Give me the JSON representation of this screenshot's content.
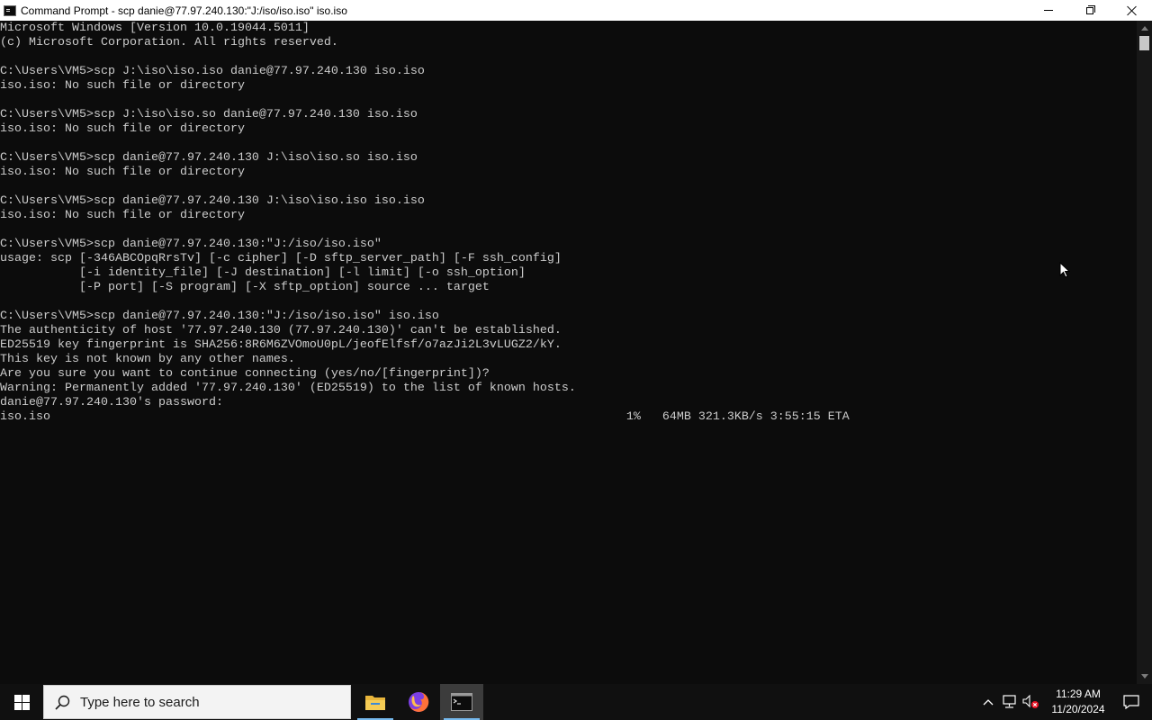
{
  "window": {
    "title": "Command Prompt - scp  danie@77.97.240.130:\"J:/iso/iso.iso\" iso.iso",
    "icon": "cmd-icon",
    "controls": [
      "minimize-icon",
      "restore-icon",
      "close-icon"
    ]
  },
  "console": {
    "lines": [
      "Microsoft Windows [Version 10.0.19044.5011]",
      "(c) Microsoft Corporation. All rights reserved.",
      "",
      "C:\\Users\\VM5>scp J:\\iso\\iso.iso danie@77.97.240.130 iso.iso",
      "iso.iso: No such file or directory",
      "",
      "C:\\Users\\VM5>scp J:\\iso\\iso.so danie@77.97.240.130 iso.iso",
      "iso.iso: No such file or directory",
      "",
      "C:\\Users\\VM5>scp danie@77.97.240.130 J:\\iso\\iso.so iso.iso",
      "iso.iso: No such file or directory",
      "",
      "C:\\Users\\VM5>scp danie@77.97.240.130 J:\\iso\\iso.iso iso.iso",
      "iso.iso: No such file or directory",
      "",
      "C:\\Users\\VM5>scp danie@77.97.240.130:\"J:/iso/iso.iso\"",
      "usage: scp [-346ABCOpqRrsTv] [-c cipher] [-D sftp_server_path] [-F ssh_config]",
      "           [-i identity_file] [-J destination] [-l limit] [-o ssh_option]",
      "           [-P port] [-S program] [-X sftp_option] source ... target",
      "",
      "C:\\Users\\VM5>scp danie@77.97.240.130:\"J:/iso/iso.iso\" iso.iso",
      "The authenticity of host '77.97.240.130 (77.97.240.130)' can't be established.",
      "ED25519 key fingerprint is SHA256:8R6M6ZVOmoU0pL/jeofElfsf/o7azJi2L3vLUGZ2/kY.",
      "This key is not known by any other names.",
      "Are you sure you want to continue connecting (yes/no/[fingerprint])?",
      "Warning: Permanently added '77.97.240.130' (ED25519) to the list of known hosts.",
      "danie@77.97.240.130's password:",
      "iso.iso                                                                                1%   64MB 321.3KB/s 3:55:15 ETA"
    ]
  },
  "taskbar": {
    "start_icon": "windows-logo-icon",
    "search_placeholder": "Type here to search",
    "apps": [
      {
        "name": "file-explorer-icon",
        "active": false
      },
      {
        "name": "firefox-icon",
        "active": false
      },
      {
        "name": "command-prompt-icon",
        "active": true
      }
    ],
    "tray": {
      "icons": [
        "chevron-up-icon",
        "network-icon",
        "volume-muted-icon"
      ],
      "time": "11:29 AM",
      "date": "11/20/2024",
      "notification_icon": "notification-icon"
    }
  },
  "colors": {
    "console_bg": "#0c0c0c",
    "console_fg": "#cccccc",
    "taskbar_bg": "#101010",
    "active_indicator": "#76b9ed"
  }
}
